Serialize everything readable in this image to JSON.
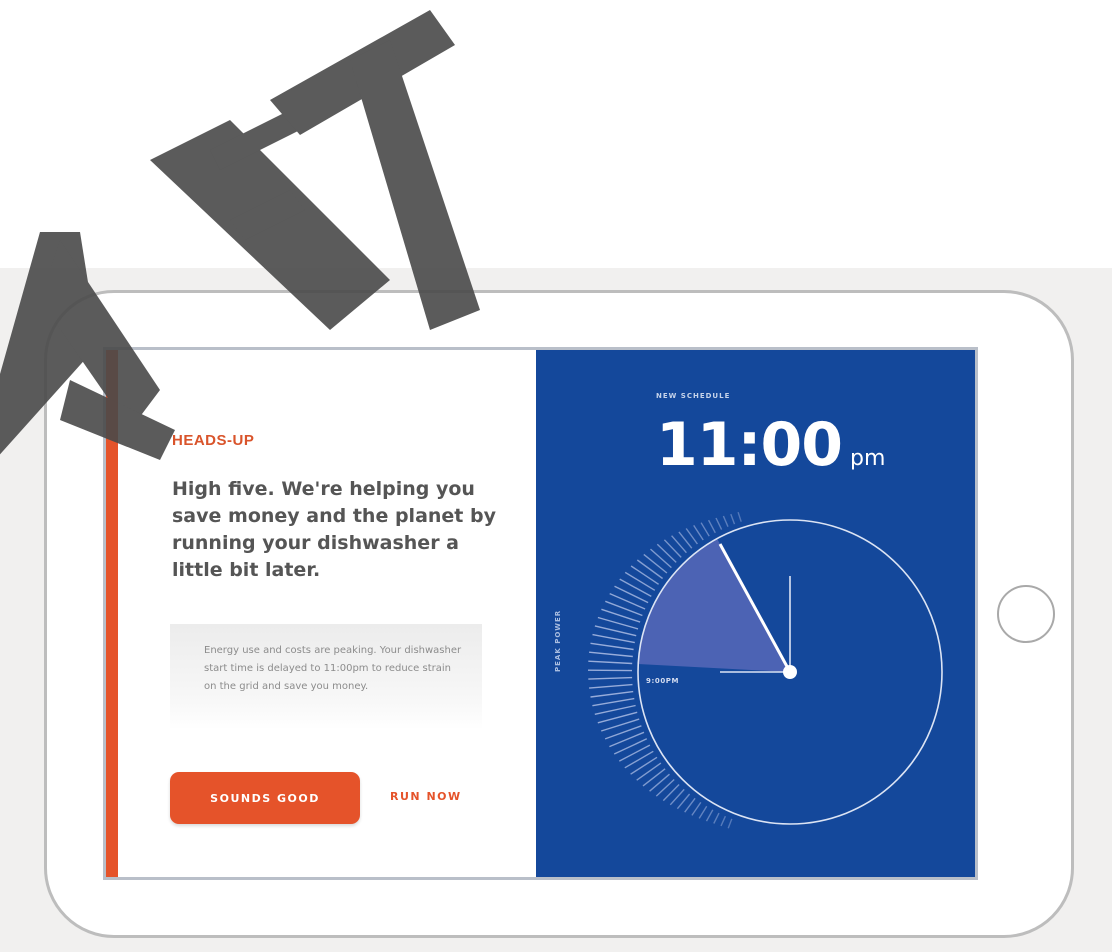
{
  "watermark": {
    "text": "AFT"
  },
  "left": {
    "eyebrow": "HEADS-UP",
    "headline": "High five. We're helping you save money and the planet by running your dishwasher a little bit later.",
    "info": "Energy use and costs are peaking. Your dishwasher start time is delayed to 11:00pm to reduce strain on the grid and save you money.",
    "primary_button": "SOUNDS GOOD",
    "secondary_button": "RUN NOW"
  },
  "right": {
    "schedule_label": "NEW SCHEDULE",
    "time": "11:00",
    "time_unit": "pm",
    "peak_label": "PEAK POWER",
    "marker_label": "9:00PM"
  },
  "colors": {
    "accent": "#e5532a",
    "panel_blue": "#14489b"
  },
  "icons": {
    "clock": "clock-dial-icon",
    "home": "home-button-icon"
  }
}
